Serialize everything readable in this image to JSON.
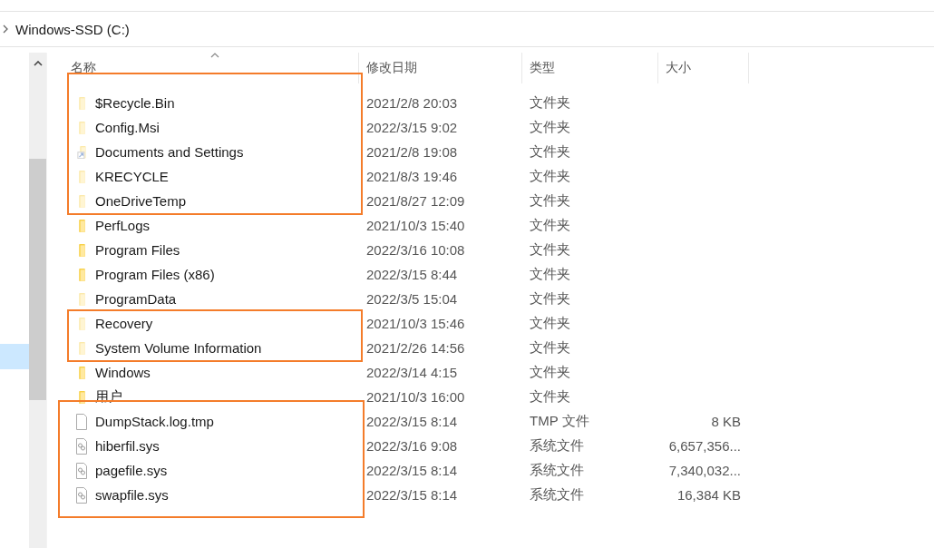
{
  "breadcrumb": {
    "location": "Windows-SSD (C:)"
  },
  "columns": [
    {
      "label": "名称",
      "sorted": true
    },
    {
      "label": "修改日期",
      "sorted": false
    },
    {
      "label": "类型",
      "sorted": false
    },
    {
      "label": "大小",
      "sorted": false
    }
  ],
  "row_groups": [
    {
      "highlighted": true,
      "rows": [
        {
          "name": "$Recycle.Bin",
          "kind": "folder",
          "hidden": true,
          "date": "2021/2/8 20:03",
          "type": "文件夹"
        },
        {
          "name": "Config.Msi",
          "kind": "folder",
          "hidden": true,
          "date": "2022/3/15 9:02",
          "type": "文件夹"
        },
        {
          "name": "Documents and Settings",
          "kind": "shortcut",
          "hidden": true,
          "date": "2021/2/8 19:08",
          "type": "文件夹"
        },
        {
          "name": "KRECYCLE",
          "kind": "folder",
          "hidden": true,
          "date": "2021/8/3 19:46",
          "type": "文件夹"
        },
        {
          "name": "OneDriveTemp",
          "kind": "folder",
          "hidden": true,
          "date": "2021/8/27 12:09",
          "type": "文件夹"
        }
      ]
    },
    {
      "highlighted": false,
      "rows": [
        {
          "name": "PerfLogs",
          "kind": "folder",
          "hidden": false,
          "date": "2021/10/3 15:40",
          "type": "文件夹"
        },
        {
          "name": "Program Files",
          "kind": "folder",
          "hidden": false,
          "date": "2022/3/16 10:08",
          "type": "文件夹"
        },
        {
          "name": "Program Files (x86)",
          "kind": "folder",
          "hidden": false,
          "date": "2022/3/15 8:44",
          "type": "文件夹"
        },
        {
          "name": "ProgramData",
          "kind": "folder",
          "hidden": true,
          "date": "2022/3/5 15:04",
          "type": "文件夹"
        }
      ]
    },
    {
      "highlighted": true,
      "rows": [
        {
          "name": "Recovery",
          "kind": "folder",
          "hidden": true,
          "date": "2021/10/3 15:46",
          "type": "文件夹"
        },
        {
          "name": "System Volume Information",
          "kind": "folder",
          "hidden": true,
          "date": "2021/2/26 14:56",
          "type": "文件夹"
        }
      ]
    },
    {
      "highlighted": false,
      "rows": [
        {
          "name": "Windows",
          "kind": "folder",
          "hidden": false,
          "date": "2022/3/14 4:15",
          "type": "文件夹"
        },
        {
          "name": "用户",
          "kind": "folder",
          "hidden": false,
          "date": "2021/10/3 16:00",
          "type": "文件夹"
        }
      ]
    },
    {
      "highlighted": true,
      "rows": [
        {
          "name": "DumpStack.log.tmp",
          "kind": "file",
          "hidden": false,
          "date": "2022/3/15 8:14",
          "type": "TMP 文件",
          "size": "8 KB"
        },
        {
          "name": "hiberfil.sys",
          "kind": "system",
          "hidden": false,
          "date": "2022/3/16 9:08",
          "type": "系统文件",
          "size": "6,657,356..."
        },
        {
          "name": "pagefile.sys",
          "kind": "system",
          "hidden": false,
          "date": "2022/3/15 8:14",
          "type": "系统文件",
          "size": "7,340,032..."
        },
        {
          "name": "swapfile.sys",
          "kind": "system",
          "hidden": false,
          "date": "2022/3/15 8:14",
          "type": "系统文件",
          "size": "16,384 KB"
        }
      ]
    }
  ]
}
